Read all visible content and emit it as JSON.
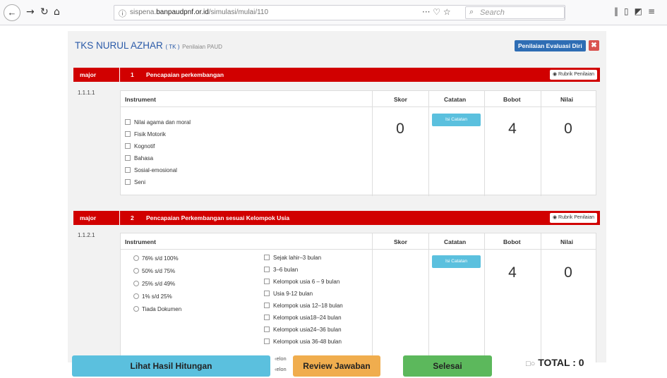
{
  "browser": {
    "url_prefix": "sispena.",
    "url_host": "banpaudpnf.or.id",
    "url_path": "/simulasi/mulai/110",
    "search_placeholder": "Search",
    "overflow": "···"
  },
  "header": {
    "school": "TKS NURUL AZHAR",
    "level": "( TK )",
    "subtitle": "Penilaian PAUD",
    "eval_button": "Penilaian Evaluasi Diri",
    "close": "✖"
  },
  "columns": {
    "instrument": "Instrument",
    "skor": "Skor",
    "catatan": "Catatan",
    "bobot": "Bobot",
    "nilai": "Nilai"
  },
  "sections": [
    {
      "type": "major",
      "number": "1",
      "title": "Pencapaian perkembangan",
      "rubrik": "Rubrik Penilaian",
      "code": "1.1.1.1",
      "checkboxes": [
        "Nilai agama dan moral",
        "Fisik Motorik",
        "Kognotif",
        "Bahasa",
        "Sosial-emosional",
        "Seni"
      ],
      "skor": "0",
      "catatan_btn": "Isi Catatan",
      "bobot": "4",
      "nilai": "0"
    },
    {
      "type": "major",
      "number": "2",
      "title": "Pencapaian Perkembangan sesuai Kelompok Usia",
      "rubrik": "Rubrik Penilaian",
      "code": "1.1.2.1",
      "radios": [
        "76% s/d 100%",
        "50% s/d 75%",
        "25% s/d 49%",
        "1% s/d 25%",
        "Tiada Dokumen"
      ],
      "checkboxes": [
        "Sejak lahir–3 bulan",
        "3–6 bulan",
        "Kelompok usia 6 – 9 bulan",
        "Usia 9-12 bulan",
        "Kelompok usia 12–18 bulan",
        "Kelompok usia18–24 bulan",
        "Kelompok usia24–36 bulan",
        "Kelompok usia 36-48 bulan"
      ],
      "partial": [
        "‹elon",
        "‹elon"
      ],
      "skor": "",
      "catatan_btn": "Isi Catatan",
      "bobot": "4",
      "nilai": "0"
    }
  ],
  "footer": {
    "lihat": "Lihat Hasil Hitungan",
    "review": "Review Jawaban",
    "selesai": "Selesai",
    "total": "TOTAL : 0",
    "colors": {
      "lihat": "#5bc0de",
      "review": "#f0ad4e",
      "selesai": "#5cb85c"
    }
  }
}
